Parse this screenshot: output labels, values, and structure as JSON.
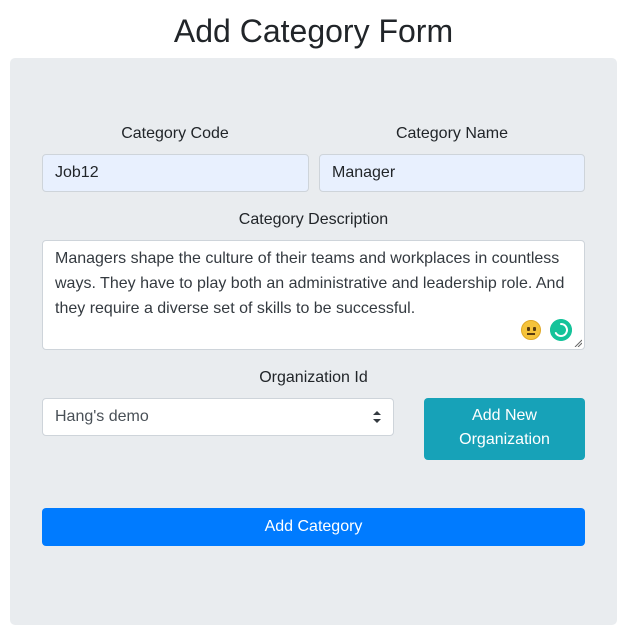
{
  "page": {
    "title": "Add Category Form"
  },
  "form": {
    "category_code": {
      "label": "Category Code",
      "value": "Job12"
    },
    "category_name": {
      "label": "Category Name",
      "value": "Manager"
    },
    "category_description": {
      "label": "Category Description",
      "value": "Managers shape the culture of their teams and workplaces in countless ways. They have to play both an administrative and leadership role. And they require a diverse set of skills to be successful."
    },
    "organization_id": {
      "label": "Organization Id",
      "selected": "Hang's demo"
    },
    "add_organization_button": {
      "label_line1": "Add New",
      "label_line2": "Organization"
    },
    "submit_button": {
      "label": "Add Category"
    },
    "textarea_icons": {
      "emoji": "neutral-face-icon",
      "assistant": "grammarly-icon"
    }
  },
  "colors": {
    "card_background": "#e9ecef",
    "autofill_background": "#e8f0fe",
    "info_button": "#17a2b8",
    "primary_button": "#007bff"
  }
}
